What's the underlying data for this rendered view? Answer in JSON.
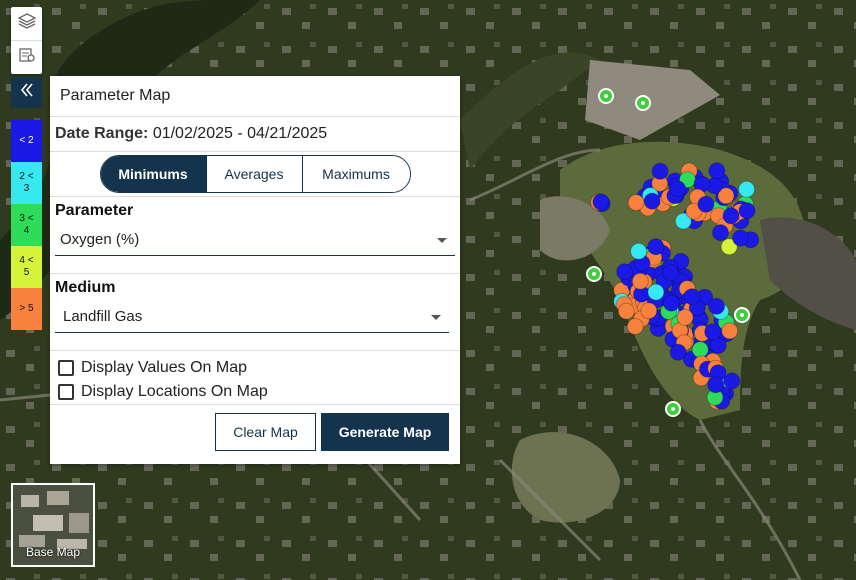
{
  "tools": {
    "layers_icon": "layers-icon",
    "legend_icon": "legend-icon",
    "collapse_icon": "double-chevron-left-icon"
  },
  "legend": [
    {
      "label": "< 2",
      "color": "#1a19e6",
      "text_color": "#ffffff"
    },
    {
      "label": "2 <\n3",
      "color": "#36e8ef",
      "text_color": "#111111"
    },
    {
      "label": "3 <\n4",
      "color": "#2edc5a",
      "text_color": "#111111"
    },
    {
      "label": "4 <\n5",
      "color": "#d5f33a",
      "text_color": "#111111"
    },
    {
      "label": "> 5",
      "color": "#f7813d",
      "text_color": "#111111"
    }
  ],
  "panel": {
    "title": "Parameter Map",
    "date_range_label": "Date Range:",
    "date_range_value": "01/02/2025 - 04/21/2025",
    "stat_tabs": [
      {
        "label": "Minimums",
        "active": true
      },
      {
        "label": "Averages",
        "active": false
      },
      {
        "label": "Maximums",
        "active": false
      }
    ],
    "parameter_label": "Parameter",
    "parameter_value": "Oxygen (%)",
    "medium_label": "Medium",
    "medium_value": "Landfill Gas",
    "display_values_label": "Display Values On Map",
    "display_values_checked": false,
    "display_locations_label": "Display Locations On Map",
    "display_locations_checked": false,
    "clear_button": "Clear Map",
    "generate_button": "Generate Map"
  },
  "basemap": {
    "label": "Base Map"
  },
  "colors": {
    "navy": "#14334d",
    "blue": "#1a19e6",
    "cyan": "#36e8ef",
    "green": "#2edc5a",
    "yellow": "#d5f33a",
    "orange": "#f7813d",
    "location_marker": "#3ccf3a"
  }
}
